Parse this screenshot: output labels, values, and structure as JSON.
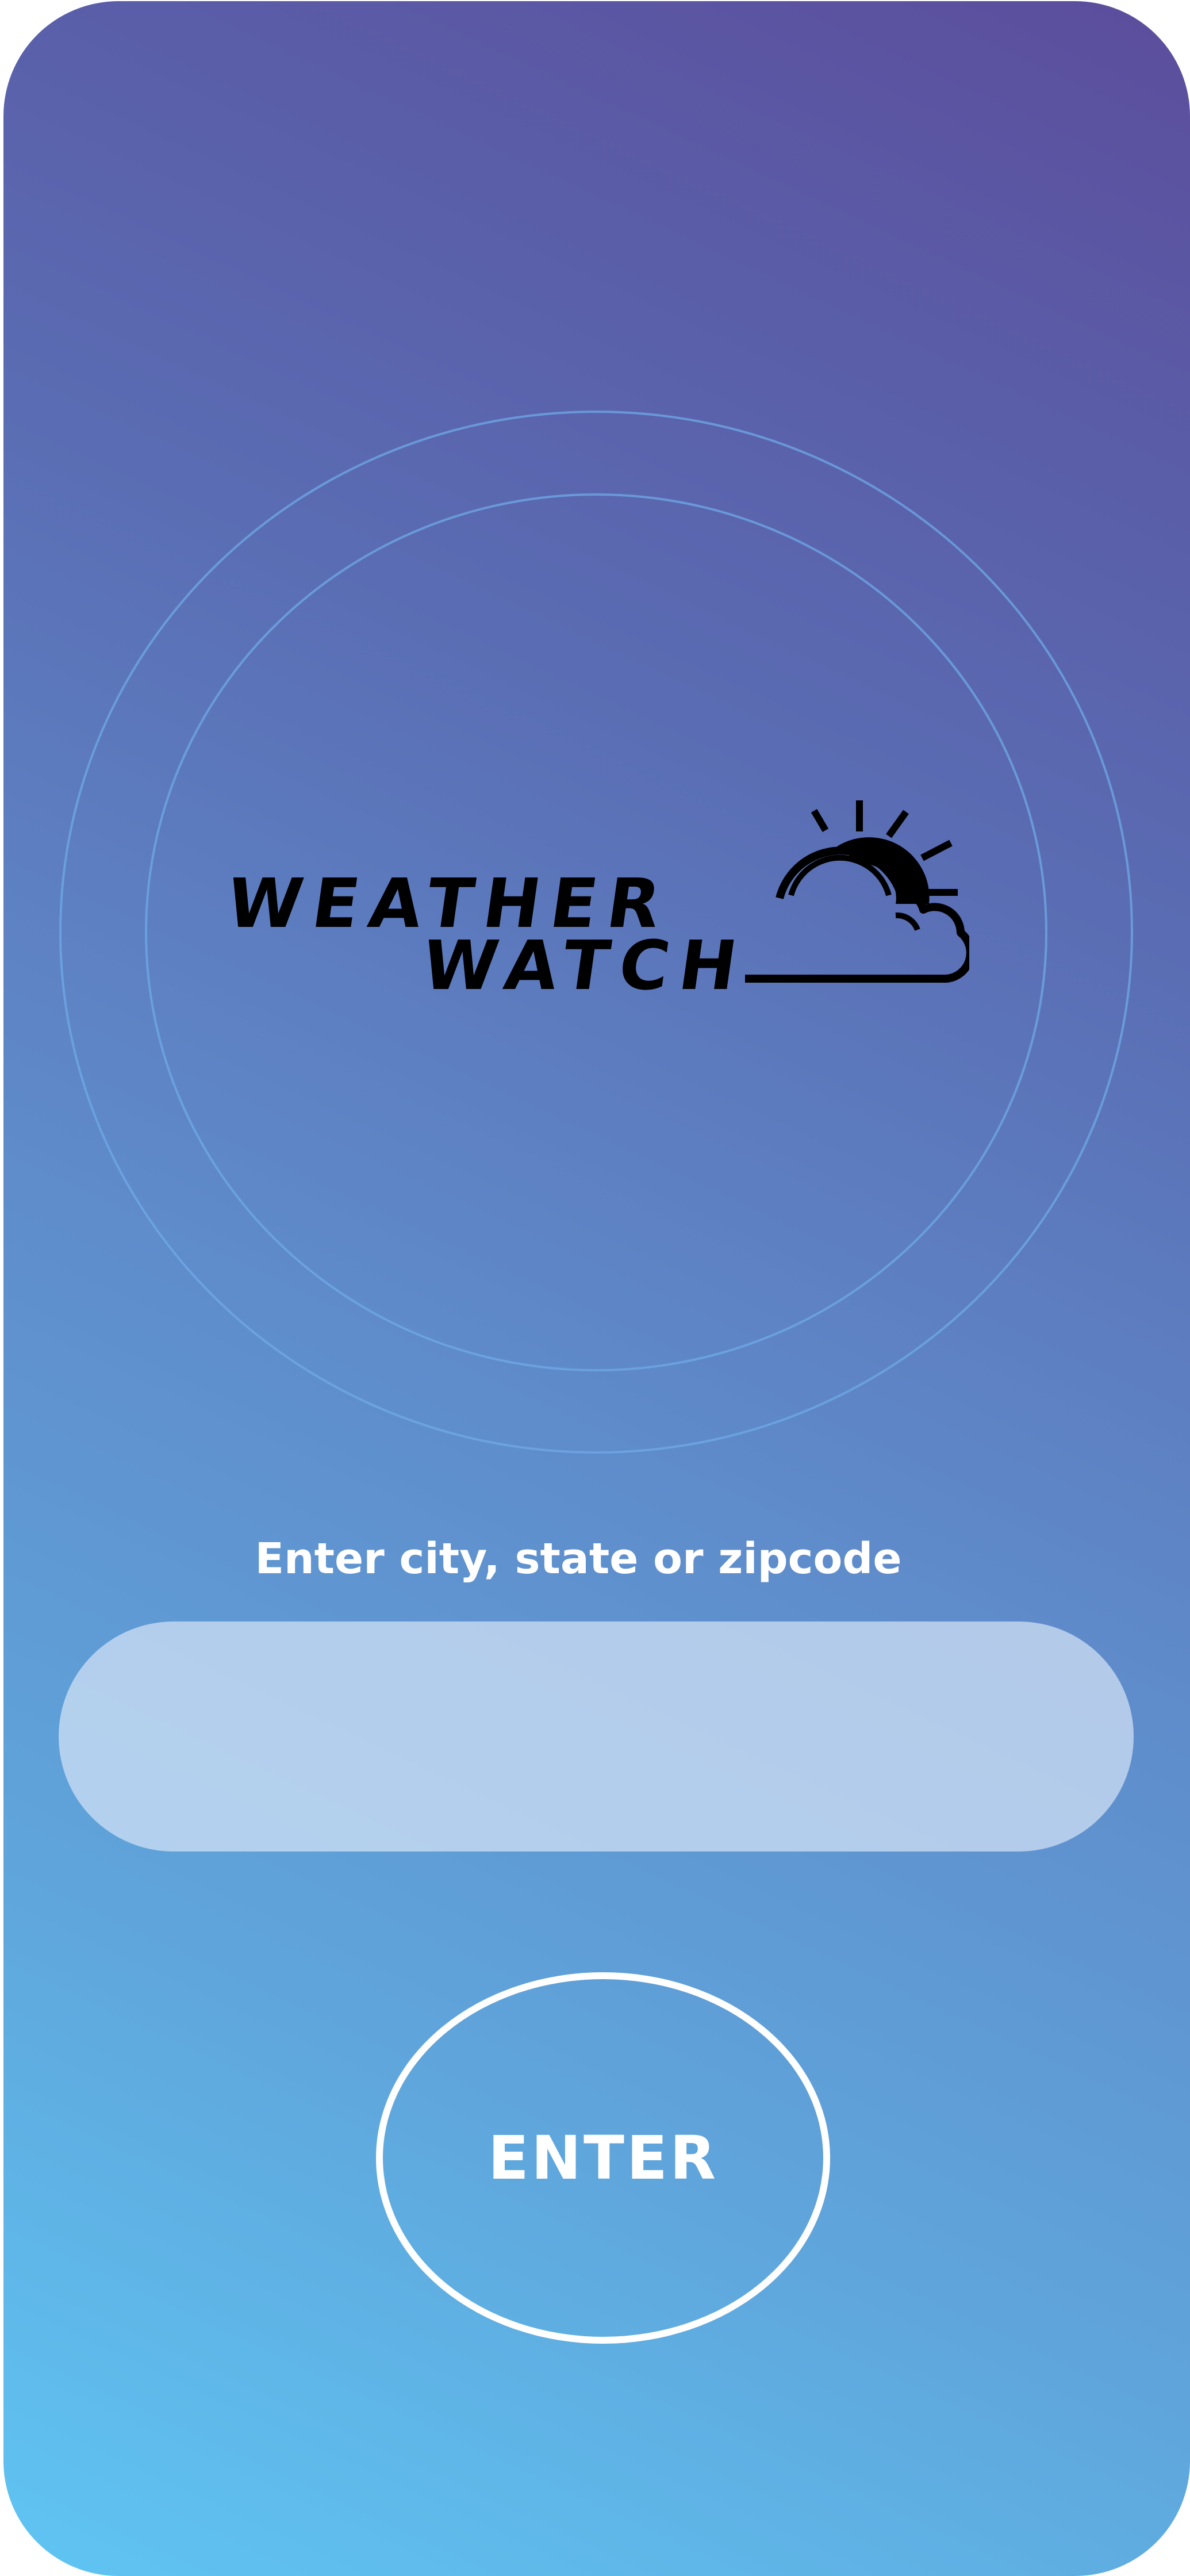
{
  "app": {
    "logo": {
      "line1": "WEATHER",
      "line2": "WATCH",
      "icon": "sun-cloud-icon"
    }
  },
  "search": {
    "label": "Enter city, state or zipcode",
    "value": "",
    "placeholder": ""
  },
  "actions": {
    "enter_label": "ENTER"
  },
  "colors": {
    "gradient_top": "#5b4d9c",
    "gradient_bottom": "#5fc5f3",
    "ring": "#6faae6",
    "input_fill": "#dce8f8",
    "button_outline": "#ffffff"
  }
}
